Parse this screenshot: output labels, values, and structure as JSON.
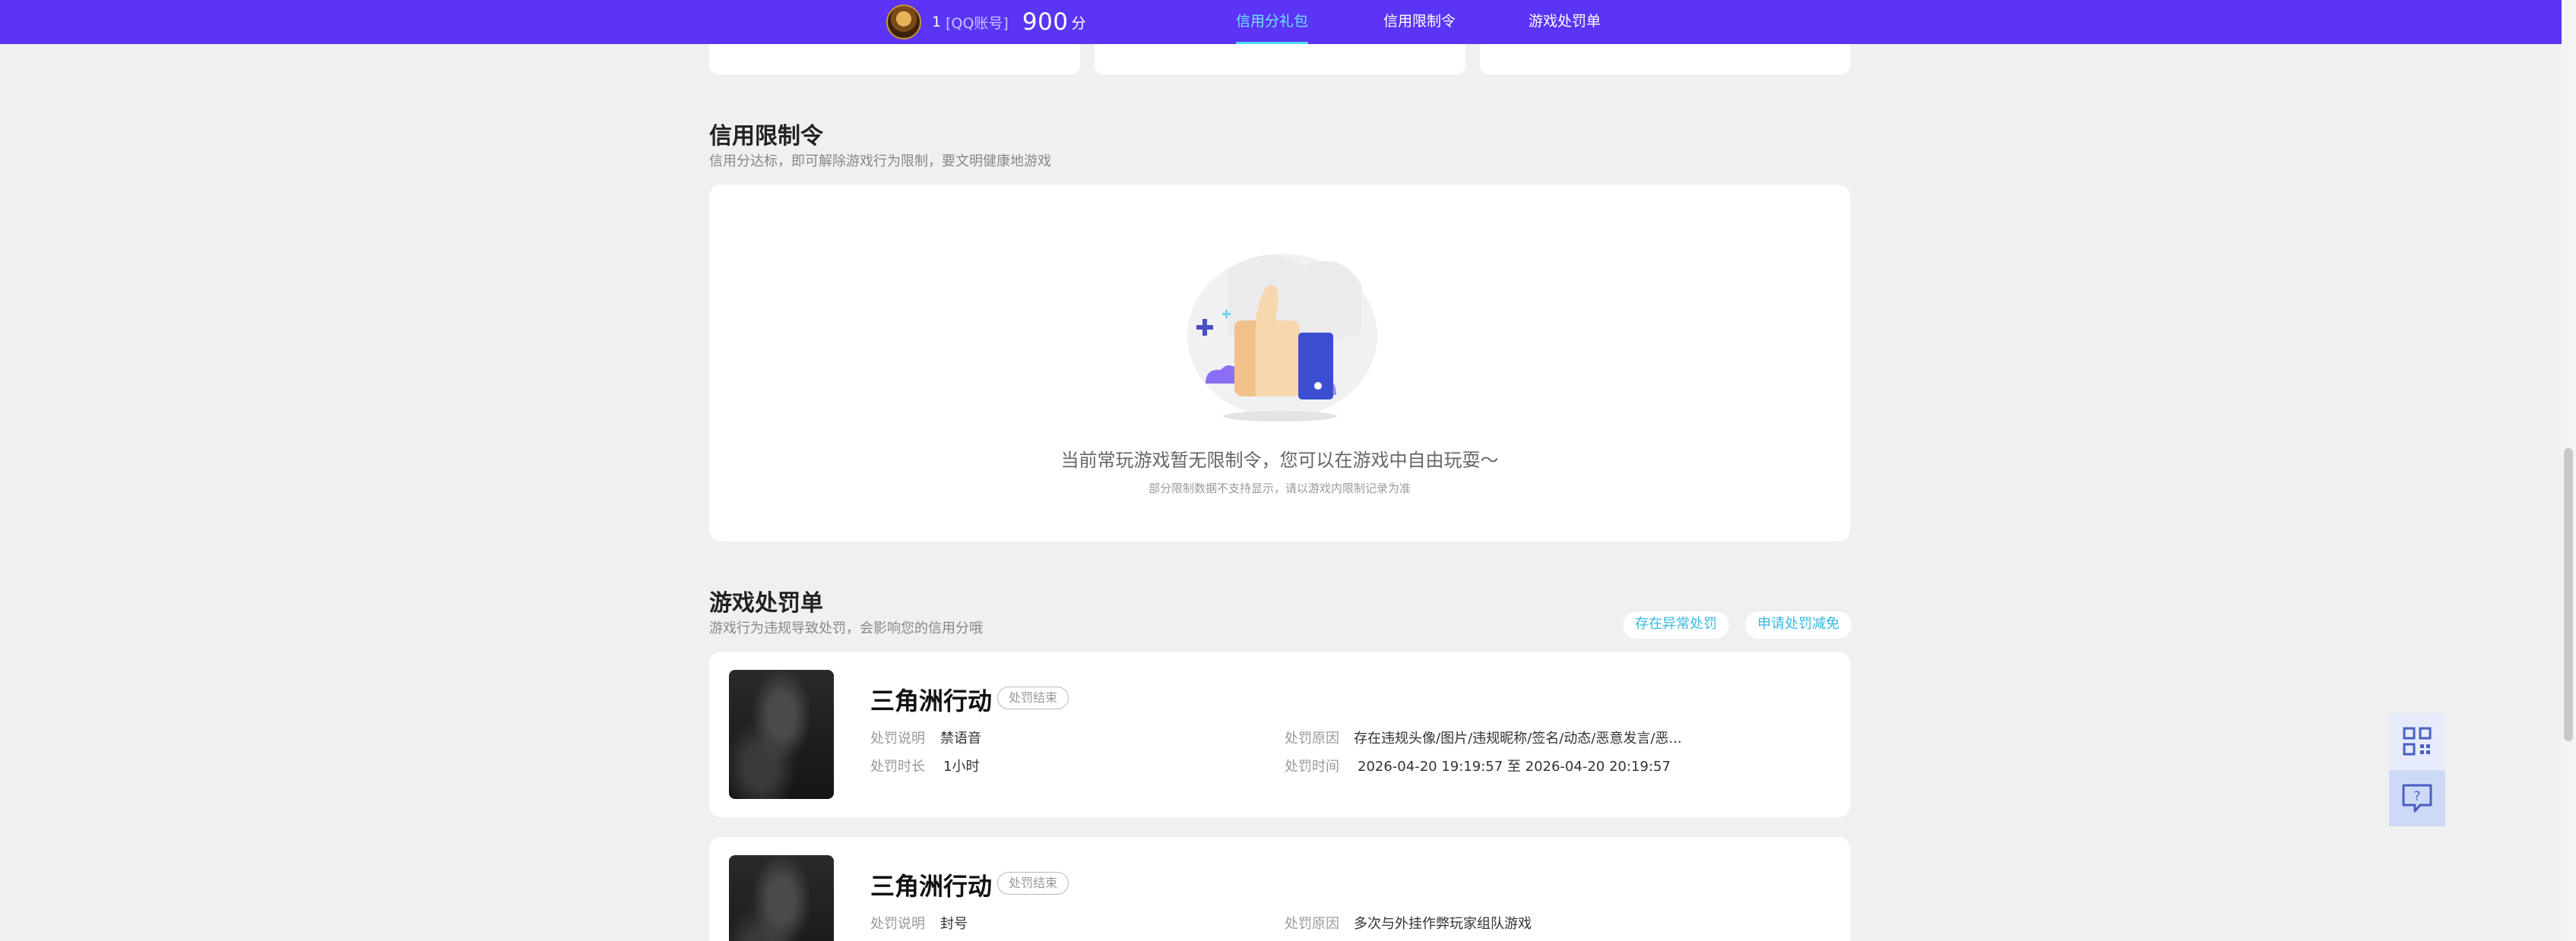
{
  "header": {
    "user_name": "1",
    "user_tag": "[QQ账号]",
    "score": "900",
    "score_unit": "分",
    "tabs": [
      {
        "label": "信用分礼包",
        "active": true
      },
      {
        "label": "信用限制令",
        "active": false
      },
      {
        "label": "游戏处罚单",
        "active": false
      }
    ],
    "bg_color": "#5b34f5",
    "active_color": "#6fe6ff"
  },
  "restriction": {
    "title": "信用限制令",
    "subtitle": "信用分达标，即可解除游戏行为限制，要文明健康地游戏",
    "empty_title": "当前常玩游戏暂无限制令，您可以在游戏中自由玩耍～",
    "empty_note": "部分限制数据不支持显示，请以游戏内限制记录为准"
  },
  "penalty": {
    "title": "游戏处罚单",
    "subtitle": "游戏行为违规导致处罚，会影响您的信用分哦",
    "actions": [
      "存在异常处罚",
      "申请处罚减免"
    ],
    "labels": {
      "desc": "处罚说明",
      "duration": "处罚时长",
      "reason": "处罚原因",
      "time": "处罚时间"
    },
    "items": [
      {
        "game": "三角洲行动",
        "status": "处罚结束",
        "desc": "禁语音",
        "duration": "1小时",
        "reason": "存在违规头像/图片/违规昵称/签名/动态/恶意发言/恶...",
        "time": "2026-04-20 19:19:57 至 2026-04-20 20:19:57"
      },
      {
        "game": "三角洲行动",
        "status": "处罚结束",
        "desc": "封号",
        "reason": "多次与外挂作弊玩家组队游戏"
      }
    ]
  },
  "tools": [
    "qr-code-icon",
    "feedback-icon"
  ]
}
